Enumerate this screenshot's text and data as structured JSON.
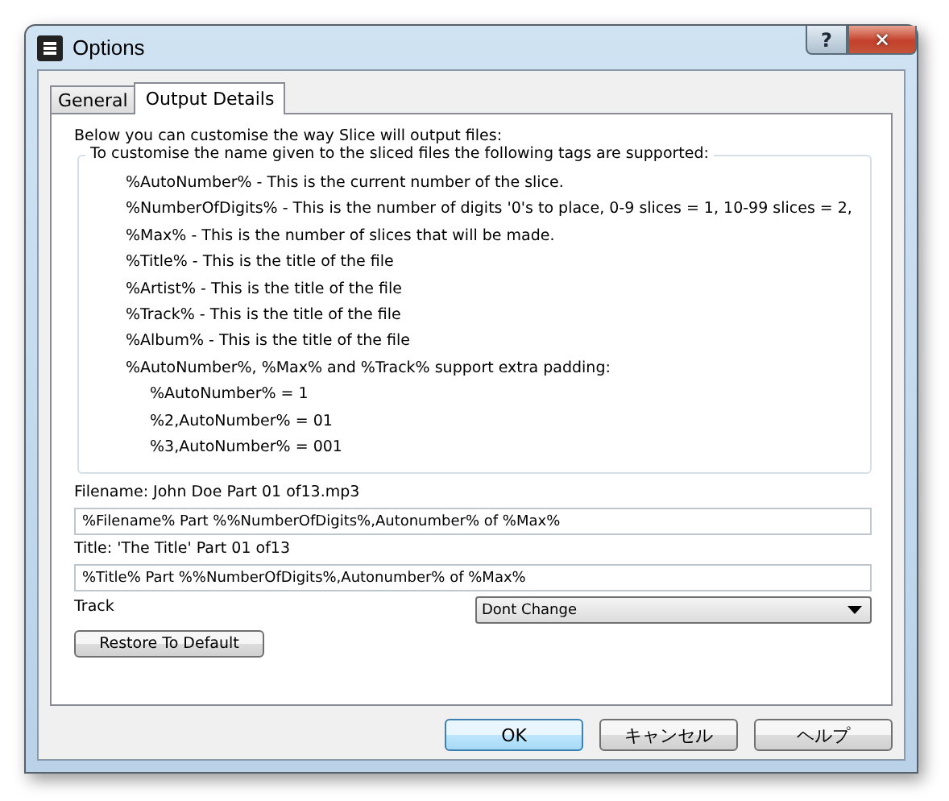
{
  "window": {
    "title": "Options"
  },
  "title_buttons": [
    {
      "kind": "help",
      "label": "?"
    },
    {
      "kind": "close",
      "label": "✕"
    }
  ],
  "tabs": [
    {
      "label": "General",
      "selected": false
    },
    {
      "label": "Output Details",
      "selected": true
    }
  ],
  "intro": "Below you can customise the way Slice will output files:",
  "tags_group": {
    "legend": "To customise the name given to the sliced files the following tags are supported:",
    "lines": [
      "%AutoNumber% - This is the current number of the slice.",
      "%NumberOfDigits% - This is the number of digits '0's to place, 0-9 slices = 1, 10-99 slices = 2,",
      "%Max% - This is the number of slices that will be made.",
      "%Title% - This is the title of the file",
      "%Artist% - This is the title of the file",
      "%Track% - This is the title of the file",
      "%Album% - This is the title of the file",
      "%AutoNumber%, %Max% and %Track% support extra padding:"
    ],
    "padding_examples": [
      "%AutoNumber% = 1",
      "%2,AutoNumber% = 01",
      "%3,AutoNumber% = 001"
    ]
  },
  "filename_preview": "Filename: John Doe Part 01 of13.mp3",
  "filename_field": {
    "value": "%Filename% Part %%NumberOfDigits%,Autonumber% of %Max%"
  },
  "title_preview": "Title: 'The Title' Part 01 of13",
  "title_field": {
    "value": "%Title% Part %%NumberOfDigits%,Autonumber% of %Max%"
  },
  "track": {
    "label": "Track",
    "value": "Dont Change"
  },
  "restore_button": "Restore To Default",
  "buttons": [
    {
      "label": "OK",
      "default": true
    },
    {
      "label": "キャンセル",
      "default": false
    },
    {
      "label": "ヘルプ",
      "default": false
    }
  ]
}
